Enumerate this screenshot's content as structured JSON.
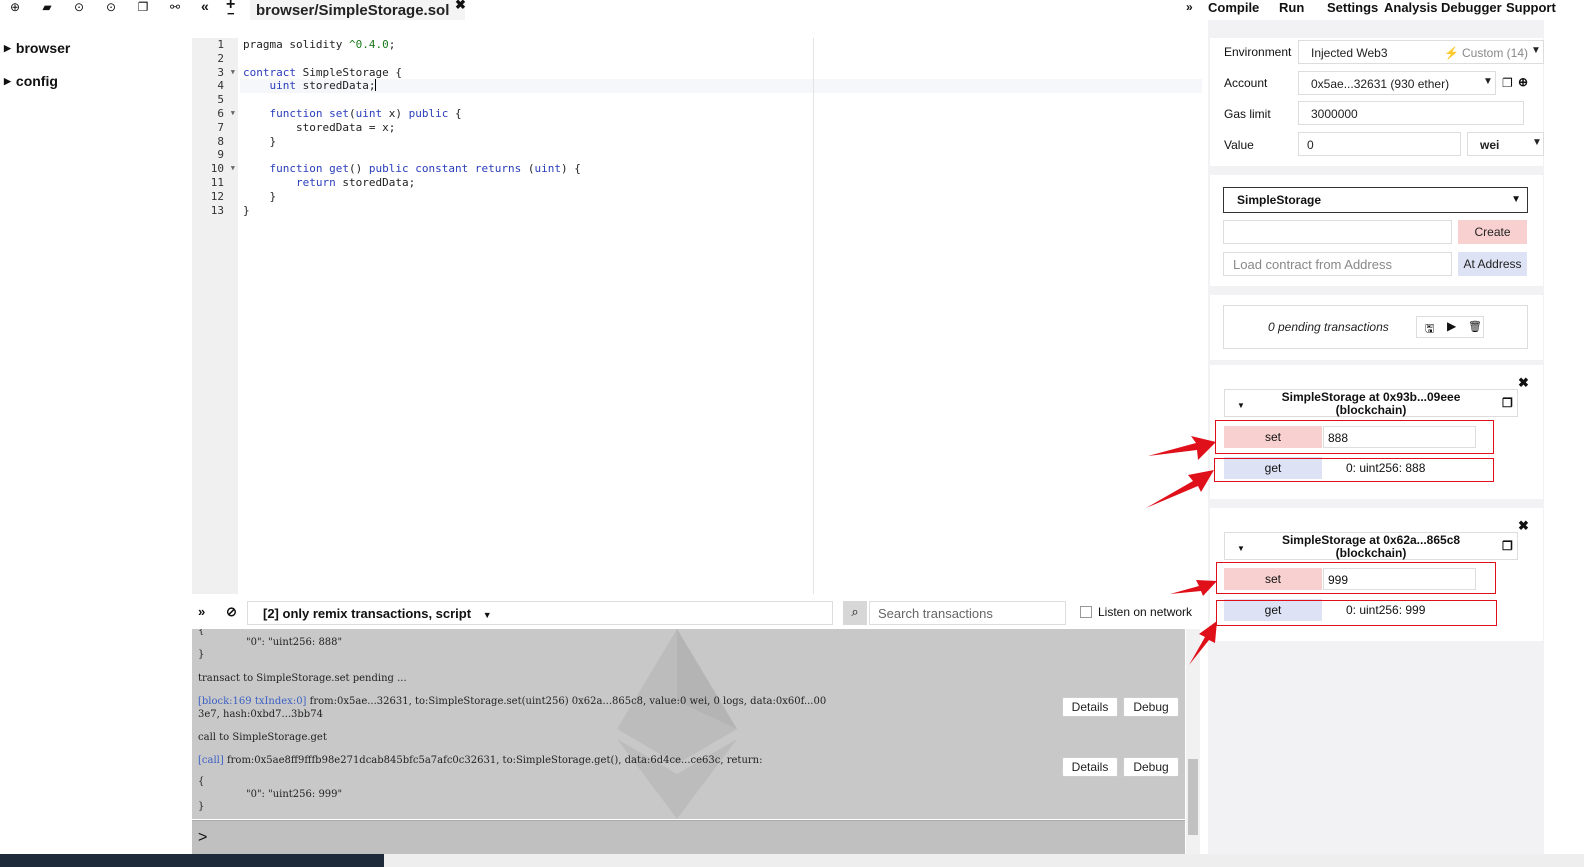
{
  "left_toolbar": {
    "icons": [
      "new-file-icon",
      "open-folder-icon",
      "github-publish-icon",
      "github-gist-icon",
      "copy-icon",
      "connect-icon"
    ]
  },
  "file_tree": {
    "items": [
      {
        "label": "browser"
      },
      {
        "label": "config"
      }
    ]
  },
  "editor": {
    "active_tab": "browser/SimpleStorage.sol",
    "line_numbers": [
      "1",
      "2",
      "3",
      "4",
      "5",
      "6",
      "7",
      "8",
      "9",
      "10",
      "11",
      "12",
      "13"
    ]
  },
  "top_menu": {
    "items": [
      "Compile",
      "Run",
      "Settings",
      "Analysis",
      "Debugger",
      "Support"
    ]
  },
  "run_panel": {
    "environment_label": "Environment",
    "environment_value": "Injected Web3",
    "environment_network": "Custom (14)",
    "account_label": "Account",
    "account_value": "0x5ae...32631 (930 ether)",
    "gas_limit_label": "Gas limit",
    "gas_limit_value": "3000000",
    "value_label": "Value",
    "value_value": "0",
    "value_unit": "wei",
    "contract_select": "SimpleStorage",
    "create_button": "Create",
    "load_placeholder": "Load contract from Address",
    "at_address_button": "At Address",
    "pending_transactions": "0 pending transactions"
  },
  "instances": [
    {
      "title_line1": "SimpleStorage at 0x93b...09eee",
      "title_line2": "(blockchain)",
      "set_label": "set",
      "set_value": "888",
      "get_label": "get",
      "get_result": "0: uint256: 888"
    },
    {
      "title_line1": "SimpleStorage at 0x62a...865c8",
      "title_line2": "(blockchain)",
      "set_label": "set",
      "set_value": "999",
      "get_label": "get",
      "get_result": "0: uint256: 999"
    }
  ],
  "terminal_toolbar": {
    "filter": "[2] only remix transactions, script",
    "search_placeholder": "Search transactions",
    "listen_label": "Listen on network"
  },
  "terminal": {
    "line_brace_close_1": "}",
    "line_result_888": "\"0\": \"uint256: 888\"",
    "line_pending": "transact to SimpleStorage.set pending ...",
    "tx_block": "[block:169 txIndex:0]",
    "tx_info": " from:0x5ae...32631, to:SimpleStorage.set(uint256) 0x62a...865c8, value:0 wei, 0 logs, data:0x60f...00",
    "tx_info2": "3e7, hash:0xbd7...3bb74",
    "line_call": "call to SimpleStorage.get",
    "call_tag": "[call]",
    "call_info": " from:0x5ae8ff9fffb98e271dcab845bfc5a7afc0c32631, to:SimpleStorage.get(), data:6d4ce...ce63c, return:",
    "line_brace_open": "{",
    "line_result_999": "\"0\": \"uint256: 999\"",
    "line_brace_close_2": "}",
    "details_button": "Details",
    "debug_button": "Debug",
    "prompt": ">"
  }
}
